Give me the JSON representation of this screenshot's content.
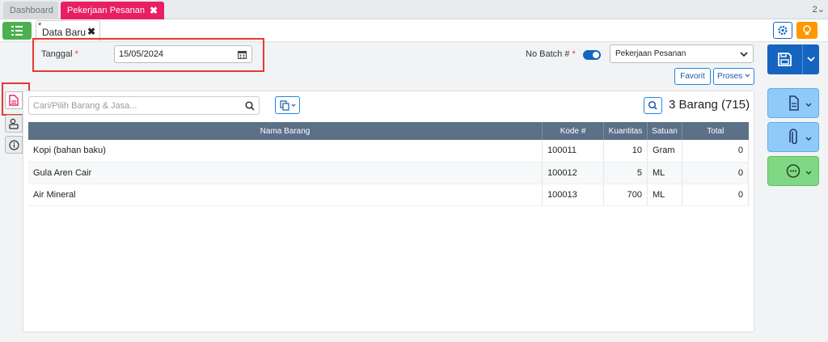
{
  "top_tabs": [
    {
      "label": "Dashboard"
    },
    {
      "label": "Pekerjaan Pesanan",
      "close": "✖"
    }
  ],
  "tab_count": "2⌄",
  "doc_tab": {
    "marker": "*",
    "label": "Data Baru",
    "close": "✖"
  },
  "form": {
    "date_label": "Tanggal",
    "required_mark": "*",
    "date_value": "15/05/2024",
    "batch_label": "No Batch #",
    "batch_toggle_on": true,
    "type_select": "Pekerjaan Pesanan",
    "favorite_label": "Favorit",
    "process_label": "Proses"
  },
  "item_search": {
    "placeholder": "Cari/Pilih Barang & Jasa...",
    "count_text": "3 Barang (715)"
  },
  "table": {
    "headers": [
      "Nama Barang",
      "Kode #",
      "Kuantitas",
      "Satuan",
      "Total"
    ],
    "rows": [
      {
        "name": "Kopi (bahan baku)",
        "code": "100011",
        "qty": "10",
        "unit": "Gram",
        "total": "0"
      },
      {
        "name": "Gula Aren Cair",
        "code": "100012",
        "qty": "5",
        "unit": "ML",
        "total": "0"
      },
      {
        "name": "Air Mineral",
        "code": "100013",
        "qty": "700",
        "unit": "ML",
        "total": "0"
      }
    ]
  },
  "icons": {
    "menu": "list-icon",
    "settings": "gear-icon",
    "tips": "lightbulb-icon",
    "calendar": "calendar-icon",
    "search": "search-icon",
    "copy": "copy-icon",
    "save": "floppy-disk-icon",
    "document": "document-icon",
    "attachment": "paperclip-icon",
    "more": "ellipsis-circle-icon",
    "side_items": "document-icon",
    "side_person": "person-lock-icon",
    "side_info": "info-icon"
  },
  "colors": {
    "accent_pink": "#e91e63",
    "primary_blue": "#1565c0",
    "menu_green": "#4caf50",
    "tips_orange": "#ff9800",
    "highlight_red": "#e53935",
    "table_header": "#5c7088"
  }
}
